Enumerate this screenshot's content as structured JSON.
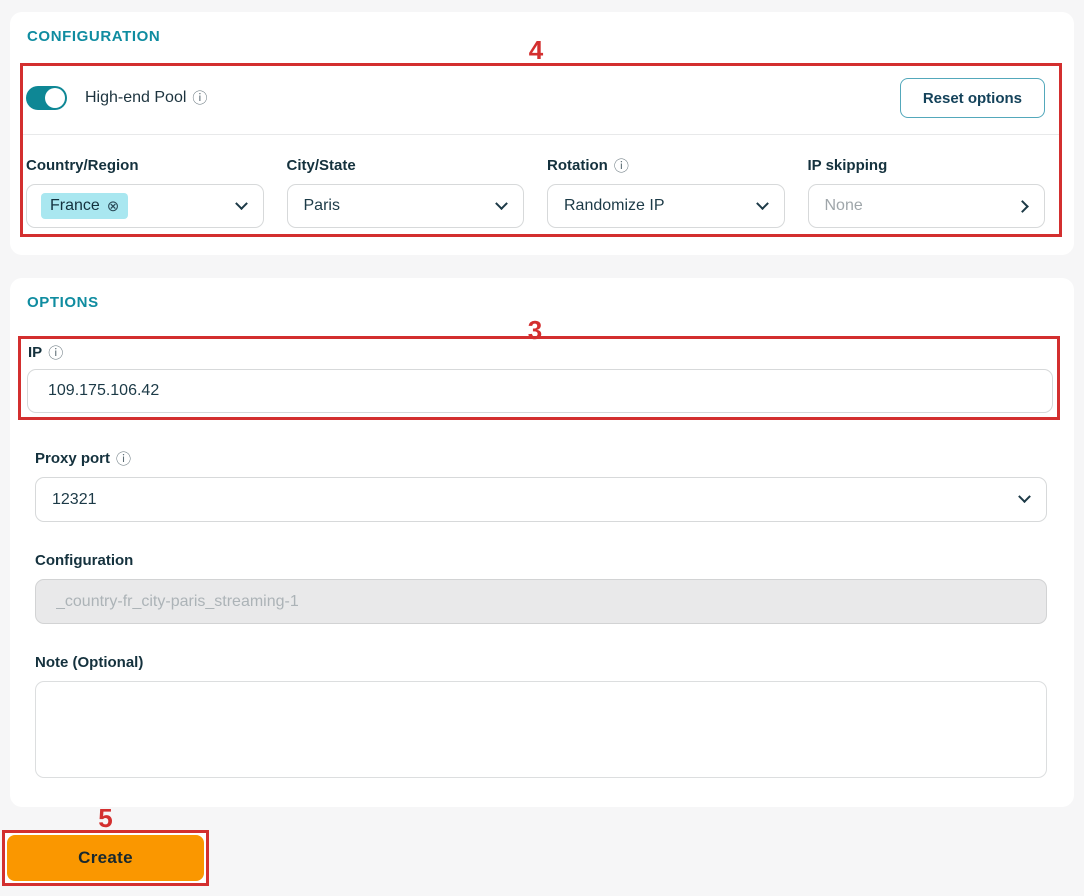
{
  "annotations": {
    "n3": "3",
    "n4": "4",
    "n5": "5"
  },
  "icons": {
    "info": "ⓘ",
    "chip_remove": "⊗"
  },
  "configuration_section": {
    "title": "CONFIGURATION",
    "high_end_pool": {
      "label": "High-end Pool",
      "enabled": true
    },
    "reset_button_label": "Reset options",
    "fields": [
      {
        "label": "Country/Region",
        "value": "France",
        "type": "chip"
      },
      {
        "label": "City/State",
        "value": "Paris",
        "type": "select"
      },
      {
        "label": "Rotation",
        "value": "Randomize IP",
        "type": "select",
        "has_info": true
      },
      {
        "label": "IP skipping",
        "value": "None",
        "type": "drill",
        "is_placeholder": true
      }
    ]
  },
  "options_section": {
    "title": "OPTIONS",
    "ip": {
      "label": "IP",
      "value": "109.175.106.42"
    },
    "proxy_port": {
      "label": "Proxy port",
      "value": "12321"
    },
    "configuration": {
      "label": "Configuration",
      "value": "_country-fr_city-paris_streaming-1",
      "disabled": true
    },
    "note": {
      "label": "Note (Optional)",
      "value": ""
    }
  },
  "create_button_label": "Create",
  "colors": {
    "accent_teal": "#0F8CA0",
    "toggle_teal": "#0E8795",
    "annotation_red": "#D32F2F",
    "create_orange": "#FA9700",
    "chip_cyan": "#A9E7F0",
    "page_background": "#F6F6F7"
  }
}
